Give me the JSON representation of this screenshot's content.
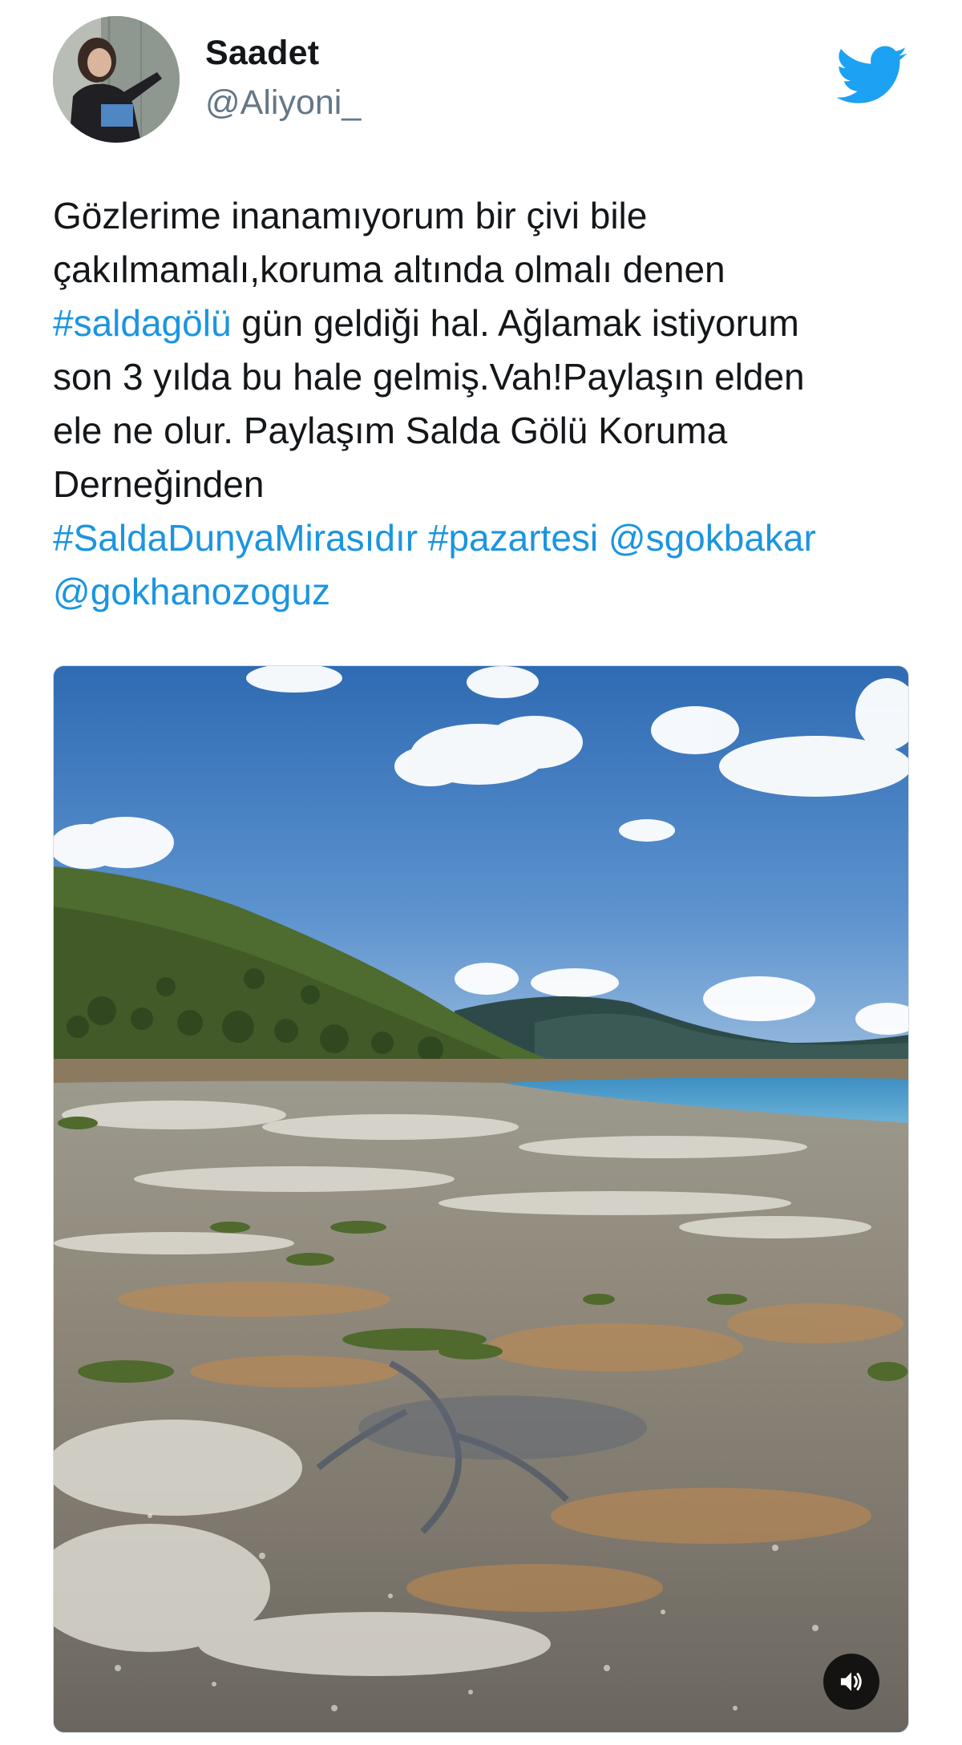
{
  "author": {
    "display_name": "Saadet",
    "handle": "@Aliyoni_",
    "avatar_icon": "profile-photo"
  },
  "brand": {
    "icon": "twitter-bird-icon",
    "color": "#1da1f2"
  },
  "tweet": {
    "lines": [
      [
        {
          "text": "Gözlerime inanamıyorum bir çivi bile",
          "type": "text"
        }
      ],
      [
        {
          "text": "çakılmamalı,koruma altında olmalı denen",
          "type": "text"
        }
      ],
      [
        {
          "text": "#saldagölü",
          "type": "hashtag"
        },
        {
          "text": " gün geldiği hal. Ağlamak istiyorum",
          "type": "text"
        }
      ],
      [
        {
          "text": "son 3 yılda bu hale gelmiş.Vah!Paylaşın elden",
          "type": "text"
        }
      ],
      [
        {
          "text": "ele ne olur. Paylaşım Salda Gölü Koruma",
          "type": "text"
        }
      ],
      [
        {
          "text": "Derneğinden",
          "type": "text"
        }
      ],
      [
        {
          "text": "#SaldaDunyaMirasıdır",
          "type": "hashtag"
        },
        {
          "text": " ",
          "type": "text"
        },
        {
          "text": "#pazartesi",
          "type": "hashtag"
        },
        {
          "text": " ",
          "type": "text"
        },
        {
          "text": "@sgokbakar",
          "type": "mention"
        }
      ],
      [
        {
          "text": "@gokhanozoguz",
          "type": "mention"
        }
      ]
    ],
    "link_color": "#1b95e0",
    "text_color": "#14171a"
  },
  "media": {
    "type": "video",
    "sound_icon": "speaker-icon"
  }
}
